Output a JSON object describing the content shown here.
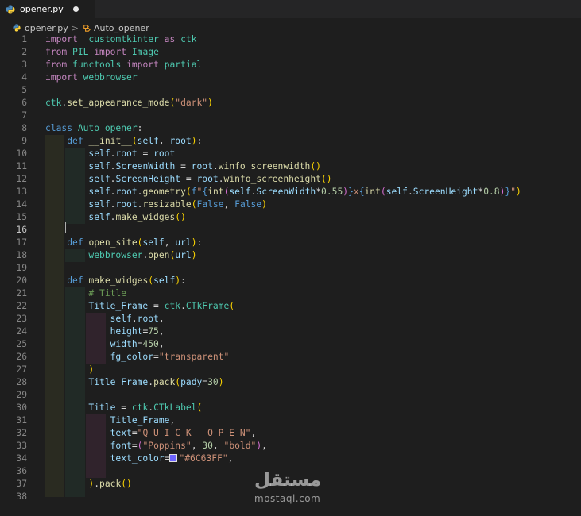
{
  "tab": {
    "filename": "opener.py",
    "icon": "python-icon",
    "modified": true
  },
  "breadcrumb": {
    "file": "opener.py",
    "separator": ">",
    "symbol": "Auto_opener",
    "symbol_icon": "class-icon"
  },
  "editor": {
    "active_line": 16
  },
  "watermark": {
    "arabic": "مستقل",
    "latin": "mostaql.com"
  },
  "colors": {
    "swatch": "#6C63FF"
  },
  "code_lines": [
    [
      [
        "kw",
        "import"
      ],
      [
        "",
        "  "
      ],
      [
        "cls",
        "customtkinter"
      ],
      [
        "",
        " "
      ],
      [
        "kw",
        "as"
      ],
      [
        "",
        " "
      ],
      [
        "cls",
        "ctk"
      ]
    ],
    [
      [
        "kw",
        "from"
      ],
      [
        "",
        " "
      ],
      [
        "cls",
        "PIL"
      ],
      [
        "",
        " "
      ],
      [
        "kw",
        "import"
      ],
      [
        "",
        " "
      ],
      [
        "cls",
        "Image"
      ]
    ],
    [
      [
        "kw",
        "from"
      ],
      [
        "",
        " "
      ],
      [
        "cls",
        "functools"
      ],
      [
        "",
        " "
      ],
      [
        "kw",
        "import"
      ],
      [
        "",
        " "
      ],
      [
        "cls",
        "partial"
      ]
    ],
    [
      [
        "kw",
        "import"
      ],
      [
        "",
        " "
      ],
      [
        "cls",
        "webbrowser"
      ]
    ],
    [],
    [
      [
        "cls",
        "ctk"
      ],
      [
        "",
        "."
      ],
      [
        "fn",
        "set_appearance_mode"
      ],
      [
        "br1",
        "("
      ],
      [
        "str",
        "\"dark\""
      ],
      [
        "br1",
        ")"
      ]
    ],
    [],
    [
      [
        "kb",
        "class"
      ],
      [
        "",
        " "
      ],
      [
        "cls",
        "Auto_opener"
      ],
      [
        "",
        ":"
      ]
    ],
    [
      [
        "",
        "    "
      ],
      [
        "kb",
        "def"
      ],
      [
        "",
        " "
      ],
      [
        "fn",
        "__init__"
      ],
      [
        "br1",
        "("
      ],
      [
        "var",
        "self"
      ],
      [
        "",
        ", "
      ],
      [
        "var",
        "root"
      ],
      [
        "br1",
        ")"
      ],
      [
        "",
        ":"
      ]
    ],
    [
      [
        "",
        "        "
      ],
      [
        "var",
        "self"
      ],
      [
        "",
        "."
      ],
      [
        "var",
        "root"
      ],
      [
        "",
        " = "
      ],
      [
        "var",
        "root"
      ]
    ],
    [
      [
        "",
        "        "
      ],
      [
        "var",
        "self"
      ],
      [
        "",
        "."
      ],
      [
        "var",
        "ScreenWidth"
      ],
      [
        "",
        " = "
      ],
      [
        "var",
        "root"
      ],
      [
        "",
        "."
      ],
      [
        "fn",
        "winfo_screenwidth"
      ],
      [
        "br1",
        "()"
      ]
    ],
    [
      [
        "",
        "        "
      ],
      [
        "var",
        "self"
      ],
      [
        "",
        "."
      ],
      [
        "var",
        "ScreenHeight"
      ],
      [
        "",
        " = "
      ],
      [
        "var",
        "root"
      ],
      [
        "",
        "."
      ],
      [
        "fn",
        "winfo_screenheight"
      ],
      [
        "br1",
        "()"
      ]
    ],
    [
      [
        "",
        "        "
      ],
      [
        "var",
        "self"
      ],
      [
        "",
        "."
      ],
      [
        "var",
        "root"
      ],
      [
        "",
        "."
      ],
      [
        "fn",
        "geometry"
      ],
      [
        "br1",
        "("
      ],
      [
        "kb",
        "f"
      ],
      [
        "str",
        "\""
      ],
      [
        "kb",
        "{"
      ],
      [
        "fn",
        "int"
      ],
      [
        "br2",
        "("
      ],
      [
        "var",
        "self"
      ],
      [
        "",
        "."
      ],
      [
        "var",
        "ScreenWidth"
      ],
      [
        "",
        "*"
      ],
      [
        "num",
        "0.55"
      ],
      [
        "br2",
        ")"
      ],
      [
        "kb",
        "}"
      ],
      [
        "str",
        "x"
      ],
      [
        "kb",
        "{"
      ],
      [
        "fn",
        "int"
      ],
      [
        "br2",
        "("
      ],
      [
        "var",
        "self"
      ],
      [
        "",
        "."
      ],
      [
        "var",
        "ScreenHeight"
      ],
      [
        "",
        "*"
      ],
      [
        "num",
        "0.8"
      ],
      [
        "br2",
        ")"
      ],
      [
        "kb",
        "}"
      ],
      [
        "str",
        "\""
      ],
      [
        "br1",
        ")"
      ]
    ],
    [
      [
        "",
        "        "
      ],
      [
        "var",
        "self"
      ],
      [
        "",
        "."
      ],
      [
        "var",
        "root"
      ],
      [
        "",
        "."
      ],
      [
        "fn",
        "resizable"
      ],
      [
        "br1",
        "("
      ],
      [
        "kb",
        "False"
      ],
      [
        "",
        ", "
      ],
      [
        "kb",
        "False"
      ],
      [
        "br1",
        ")"
      ]
    ],
    [
      [
        "",
        "        "
      ],
      [
        "var",
        "self"
      ],
      [
        "",
        "."
      ],
      [
        "fn",
        "make_widges"
      ],
      [
        "br1",
        "()"
      ]
    ],
    [],
    [
      [
        "",
        "    "
      ],
      [
        "kb",
        "def"
      ],
      [
        "",
        " "
      ],
      [
        "fn",
        "open_site"
      ],
      [
        "br1",
        "("
      ],
      [
        "var",
        "self"
      ],
      [
        "",
        ", "
      ],
      [
        "var",
        "url"
      ],
      [
        "br1",
        ")"
      ],
      [
        "",
        ":"
      ]
    ],
    [
      [
        "",
        "        "
      ],
      [
        "cls",
        "webbrowser"
      ],
      [
        "",
        "."
      ],
      [
        "fn",
        "open"
      ],
      [
        "br1",
        "("
      ],
      [
        "var",
        "url"
      ],
      [
        "br1",
        ")"
      ]
    ],
    [],
    [
      [
        "",
        "    "
      ],
      [
        "kb",
        "def"
      ],
      [
        "",
        " "
      ],
      [
        "fn",
        "make_widges"
      ],
      [
        "br1",
        "("
      ],
      [
        "var",
        "self"
      ],
      [
        "br1",
        ")"
      ],
      [
        "",
        ":"
      ]
    ],
    [
      [
        "",
        "        "
      ],
      [
        "cmt",
        "# Title"
      ]
    ],
    [
      [
        "",
        "        "
      ],
      [
        "var",
        "Title_Frame"
      ],
      [
        "",
        " = "
      ],
      [
        "cls",
        "ctk"
      ],
      [
        "",
        "."
      ],
      [
        "cls",
        "CTkFrame"
      ],
      [
        "br1",
        "("
      ]
    ],
    [
      [
        "",
        "            "
      ],
      [
        "var",
        "self"
      ],
      [
        "",
        "."
      ],
      [
        "var",
        "root"
      ],
      [
        "",
        ","
      ]
    ],
    [
      [
        "",
        "            "
      ],
      [
        "var",
        "height"
      ],
      [
        "",
        "="
      ],
      [
        "num",
        "75"
      ],
      [
        "",
        ","
      ]
    ],
    [
      [
        "",
        "            "
      ],
      [
        "var",
        "width"
      ],
      [
        "",
        "="
      ],
      [
        "num",
        "450"
      ],
      [
        "",
        ","
      ]
    ],
    [
      [
        "",
        "            "
      ],
      [
        "var",
        "fg_color"
      ],
      [
        "",
        "="
      ],
      [
        "str",
        "\"transparent\""
      ]
    ],
    [
      [
        "",
        "        "
      ],
      [
        "br1",
        ")"
      ]
    ],
    [
      [
        "",
        "        "
      ],
      [
        "var",
        "Title_Frame"
      ],
      [
        "",
        "."
      ],
      [
        "fn",
        "pack"
      ],
      [
        "br1",
        "("
      ],
      [
        "var",
        "pady"
      ],
      [
        "",
        "="
      ],
      [
        "num",
        "30"
      ],
      [
        "br1",
        ")"
      ]
    ],
    [],
    [
      [
        "",
        "        "
      ],
      [
        "var",
        "Title"
      ],
      [
        "",
        " = "
      ],
      [
        "cls",
        "ctk"
      ],
      [
        "",
        "."
      ],
      [
        "cls",
        "CTkLabel"
      ],
      [
        "br1",
        "("
      ]
    ],
    [
      [
        "",
        "            "
      ],
      [
        "var",
        "Title_Frame"
      ],
      [
        "",
        ","
      ]
    ],
    [
      [
        "",
        "            "
      ],
      [
        "var",
        "text"
      ],
      [
        "",
        "="
      ],
      [
        "str",
        "\"Q U I C K   O P E N\""
      ],
      [
        "",
        ","
      ]
    ],
    [
      [
        "",
        "            "
      ],
      [
        "var",
        "font"
      ],
      [
        "",
        "="
      ],
      [
        "br2",
        "("
      ],
      [
        "str",
        "\"Poppins\""
      ],
      [
        "",
        ", "
      ],
      [
        "num",
        "30"
      ],
      [
        "",
        ", "
      ],
      [
        "str",
        "\"bold\""
      ],
      [
        "br2",
        ")"
      ],
      [
        "",
        ","
      ]
    ],
    [
      [
        "",
        "            "
      ],
      [
        "var",
        "text_color"
      ],
      [
        "",
        "="
      ],
      [
        "swatch",
        ""
      ],
      [
        "str",
        "\"#6C63FF\""
      ],
      [
        "",
        ","
      ]
    ],
    [],
    [
      [
        "",
        "        "
      ],
      [
        "br1",
        ")"
      ],
      [
        "",
        "."
      ],
      [
        "fn",
        "pack"
      ],
      [
        "br1",
        "()"
      ]
    ],
    [],
    []
  ],
  "line_numbers": [
    "1",
    "2",
    "3",
    "4",
    "5",
    "6",
    "7",
    "8",
    "9",
    "10",
    "11",
    "12",
    "13",
    "14",
    "15",
    "16",
    "17",
    "18",
    "19",
    "20",
    "21",
    "22",
    "23",
    "24",
    "25",
    "26",
    "27",
    "28",
    "29",
    "30",
    "31",
    "32",
    "33",
    "34",
    "36",
    "37",
    "38"
  ]
}
